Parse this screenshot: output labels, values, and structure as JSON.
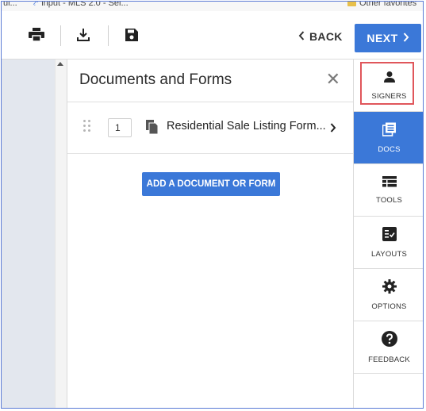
{
  "favorites": {
    "item1": "ul...",
    "item2": "input - MLS 2.0 - Sel...",
    "item3": "Other favorites"
  },
  "toolbar": {
    "print_icon": "print-icon",
    "download_icon": "download-icon",
    "save_icon": "save-icon",
    "back_label": "BACK",
    "next_label": "NEXT"
  },
  "panel": {
    "title": "Documents and Forms",
    "documents": [
      {
        "number": "1",
        "name": "Residential Sale Listing Form..."
      }
    ],
    "add_button_label": "ADD A DOCUMENT OR FORM"
  },
  "sidebar": {
    "items": [
      {
        "label": "SIGNERS",
        "icon": "person-icon",
        "active": false
      },
      {
        "label": "DOCS",
        "icon": "docs-icon",
        "active": true
      },
      {
        "label": "TOOLS",
        "icon": "table-icon",
        "active": false
      },
      {
        "label": "LAYOUTS",
        "icon": "layout-check-icon",
        "active": false
      },
      {
        "label": "OPTIONS",
        "icon": "gear-icon",
        "active": false
      },
      {
        "label": "FEEDBACK",
        "icon": "help-icon",
        "active": false
      }
    ]
  },
  "colors": {
    "accent": "#3b78d8",
    "highlight": "#e0565b",
    "frame": "#5b7bd5"
  }
}
